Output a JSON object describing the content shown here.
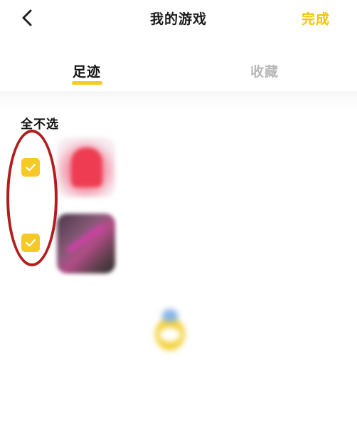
{
  "header": {
    "title": "我的游戏",
    "done_label": "完成",
    "back_icon": "chevron-left-icon"
  },
  "tabs": [
    {
      "label": "足迹",
      "active": true
    },
    {
      "label": "收藏",
      "active": false
    }
  ],
  "select_all_label": "全不选",
  "games": [
    {
      "name": "",
      "checked": true
    },
    {
      "name": "",
      "checked": true
    }
  ],
  "empty_state": {
    "caption": "",
    "footnote": ""
  },
  "colors": {
    "accent": "#f7cb1a",
    "checkbox": "#f6c925",
    "done_text": "#f5c300",
    "annotation": "#b31c1c"
  }
}
